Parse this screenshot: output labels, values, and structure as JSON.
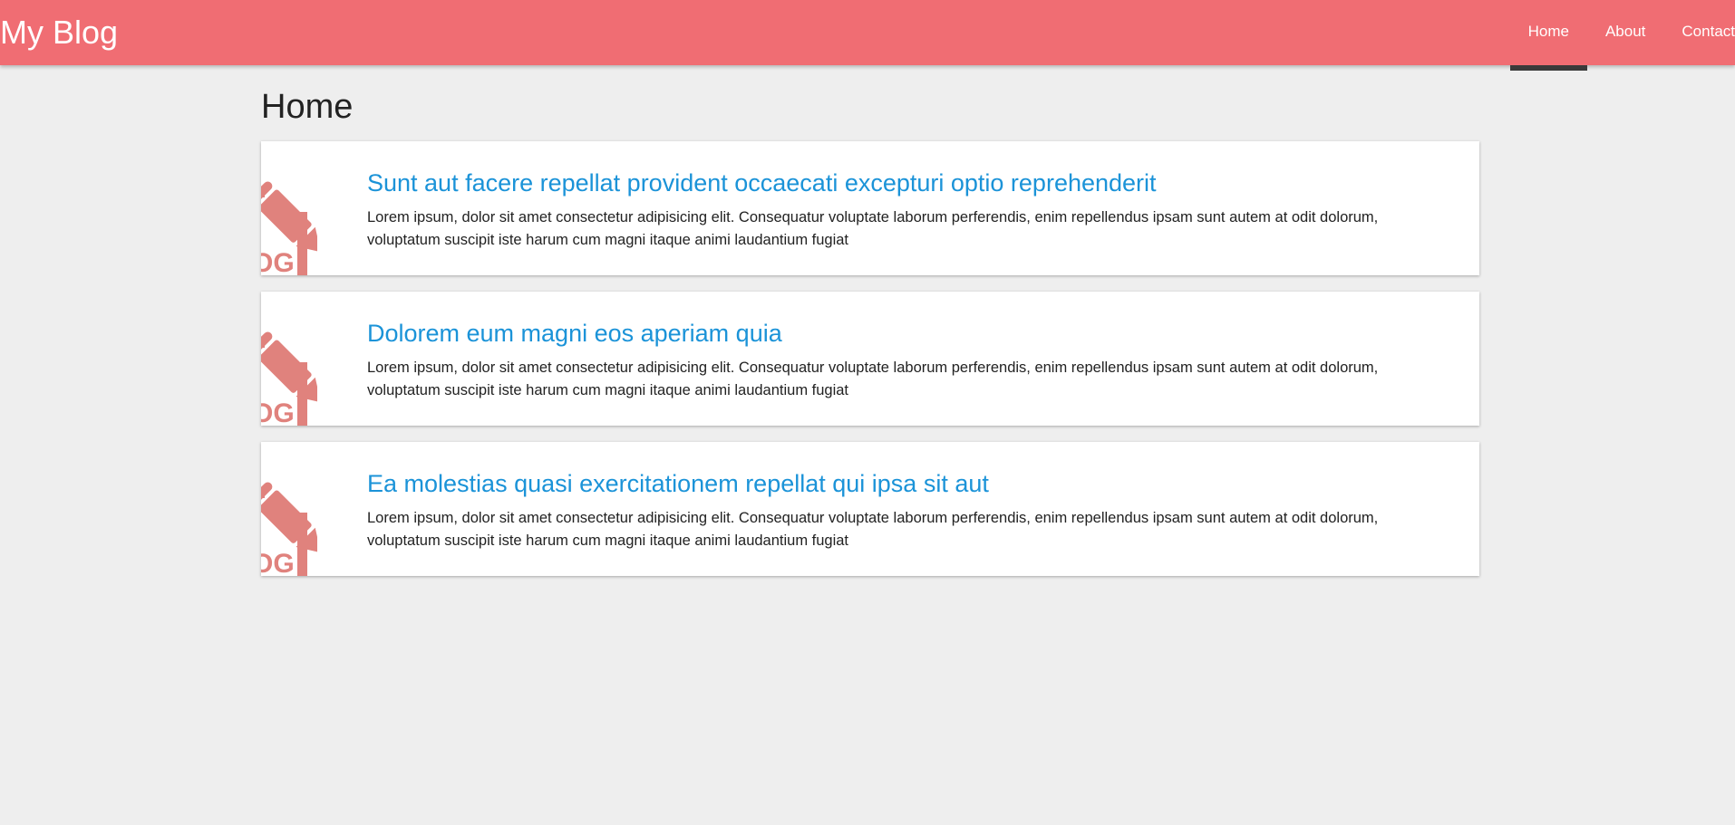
{
  "header": {
    "brand": "My Blog",
    "nav": [
      {
        "label": "Home",
        "active": true
      },
      {
        "label": "About",
        "active": false
      },
      {
        "label": "Contact",
        "active": false
      }
    ]
  },
  "main": {
    "title": "Home",
    "posts": [
      {
        "title": "Sunt aut facere repellat provident occaecati excepturi optio reprehenderit",
        "excerpt": "Lorem ipsum, dolor sit amet consectetur adipisicing elit. Consequatur voluptate laborum perferendis, enim repellendus ipsam sunt autem at odit dolorum, voluptatum suscipit iste harum cum magni itaque animi laudantium fugiat",
        "thumb_icon": "blog-pencil-icon"
      },
      {
        "title": "Dolorem eum magni eos aperiam quia",
        "excerpt": "Lorem ipsum, dolor sit amet consectetur adipisicing elit. Consequatur voluptate laborum perferendis, enim repellendus ipsam sunt autem at odit dolorum, voluptatum suscipit iste harum cum magni itaque animi laudantium fugiat",
        "thumb_icon": "blog-pencil-icon"
      },
      {
        "title": "Ea molestias quasi exercitationem repellat qui ipsa sit aut",
        "excerpt": "Lorem ipsum, dolor sit amet consectetur adipisicing elit. Consequatur voluptate laborum perferendis, enim repellendus ipsam sunt autem at odit dolorum, voluptatum suscipit iste harum cum magni itaque animi laudantium fugiat",
        "thumb_icon": "blog-pencil-icon"
      }
    ]
  },
  "colors": {
    "header_bg": "#f06d73",
    "link": "#1b93d8",
    "icon": "#e0827d",
    "active_indicator": "#3a3a3a"
  }
}
